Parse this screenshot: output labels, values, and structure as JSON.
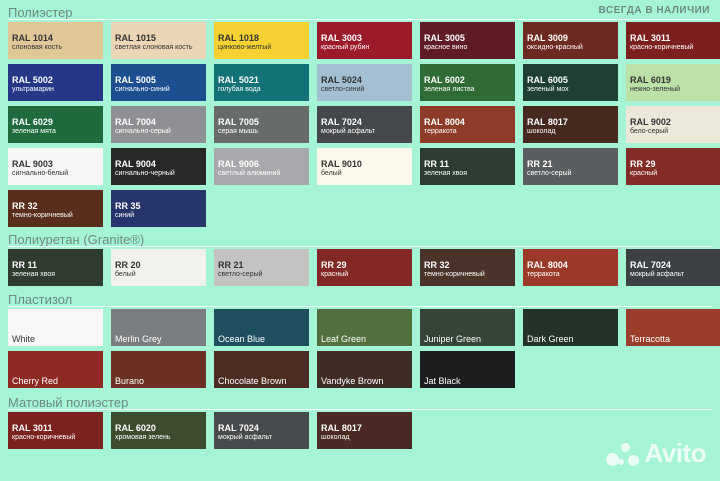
{
  "header": {
    "availability": "ВСЕГДА В НАЛИЧИИ"
  },
  "sections": [
    {
      "title": "Полиэстер",
      "swatches": [
        {
          "code": "RAL 1014",
          "name": "слоновая кость",
          "color": "#dfc798",
          "text": "light"
        },
        {
          "code": "RAL 1015",
          "name": "светлая слоновая кость",
          "color": "#ead5b5",
          "text": "light"
        },
        {
          "code": "RAL 1018",
          "name": "цинково-желтый",
          "color": "#f5d232",
          "text": "light"
        },
        {
          "code": "RAL 3003",
          "name": "красный рубин",
          "color": "#9b1b2b",
          "text": "dark"
        },
        {
          "code": "RAL 3005",
          "name": "красное вино",
          "color": "#5f1c26",
          "text": "dark"
        },
        {
          "code": "RAL 3009",
          "name": "оксидно-красный",
          "color": "#6d2a23",
          "text": "dark"
        },
        {
          "code": "RAL 3011",
          "name": "красно-коричневый",
          "color": "#7b1f1f",
          "text": "dark"
        },
        {
          "code": "RAL 5002",
          "name": "ультрамарин",
          "color": "#273788",
          "text": "dark"
        },
        {
          "code": "RAL 5005",
          "name": "сигнально-синий",
          "color": "#1d4e8f",
          "text": "dark"
        },
        {
          "code": "RAL 5021",
          "name": "голубая вода",
          "color": "#137275",
          "text": "dark"
        },
        {
          "code": "RAL 5024",
          "name": "светло-синий",
          "color": "#a4bfd2",
          "text": "light"
        },
        {
          "code": "RAL 6002",
          "name": "зеленая листва",
          "color": "#2e6b35",
          "text": "dark"
        },
        {
          "code": "RAL 6005",
          "name": "зеленый мох",
          "color": "#1f3f34",
          "text": "dark"
        },
        {
          "code": "RAL 6019",
          "name": "нежно-зеленый",
          "color": "#bde0a6",
          "text": "light"
        },
        {
          "code": "RAL 6029",
          "name": "зеленая мята",
          "color": "#1f6b3e",
          "text": "dark"
        },
        {
          "code": "RAL 7004",
          "name": "сигнально-серый",
          "color": "#8f9093",
          "text": "dark"
        },
        {
          "code": "RAL 7005",
          "name": "серая мышь",
          "color": "#676b6a",
          "text": "dark"
        },
        {
          "code": "RAL 7024",
          "name": "мокрый асфальт",
          "color": "#46494c",
          "text": "dark"
        },
        {
          "code": "RAL 8004",
          "name": "терракота",
          "color": "#8e3c27",
          "text": "dark"
        },
        {
          "code": "RAL 8017",
          "name": "шоколад",
          "color": "#45291f",
          "text": "dark"
        },
        {
          "code": "RAL 9002",
          "name": "бело-серый",
          "color": "#ece8d9",
          "text": "light"
        },
        {
          "code": "RAL 9003",
          "name": "сигнально-белый",
          "color": "#f6f6f4",
          "text": "light"
        },
        {
          "code": "RAL 9004",
          "name": "сигнально-черный",
          "color": "#282828",
          "text": "dark"
        },
        {
          "code": "RAL 9006",
          "name": "светлый алюминий",
          "color": "#a8a9ad",
          "text": "dark"
        },
        {
          "code": "RAL 9010",
          "name": "белый",
          "color": "#fcf9ea",
          "text": "light"
        },
        {
          "code": "RR 11",
          "name": "зеленая хвоя",
          "color": "#2c3c30",
          "text": "dark"
        },
        {
          "code": "RR 21",
          "name": "светло-серый",
          "color": "#5a5e60",
          "text": "dark"
        },
        {
          "code": "RR 29",
          "name": "красный",
          "color": "#832b25",
          "text": "dark"
        },
        {
          "code": "RR 32",
          "name": "темно-коричневый",
          "color": "#5a2e1c",
          "text": "dark"
        },
        {
          "code": "RR 35",
          "name": "синий",
          "color": "#26356b",
          "text": "dark"
        }
      ]
    },
    {
      "title": "Полиуретан (Granite®)",
      "swatches": [
        {
          "code": "RR 11",
          "name": "зеленая хвоя",
          "color": "#2e3b2e",
          "text": "dark"
        },
        {
          "code": "RR 20",
          "name": "белый",
          "color": "#f1f1ee",
          "text": "light"
        },
        {
          "code": "RR 21",
          "name": "светло-серый",
          "color": "#c3c4c2",
          "text": "light"
        },
        {
          "code": "RR 29",
          "name": "красный",
          "color": "#842826",
          "text": "dark"
        },
        {
          "code": "RR 32",
          "name": "темно-коричневый",
          "color": "#4a3328",
          "text": "dark"
        },
        {
          "code": "RAL 8004",
          "name": "терракота",
          "color": "#9c3a29",
          "text": "dark"
        },
        {
          "code": "RAL 7024",
          "name": "мокрый асфальт",
          "color": "#3e4143",
          "text": "dark"
        }
      ]
    },
    {
      "title": "Пластизол",
      "swatches": [
        {
          "label": "White",
          "color": "#f7f7f5",
          "text": "light"
        },
        {
          "label": "Merlin Grey",
          "color": "#7a7d80",
          "text": "dark"
        },
        {
          "label": "Ocean Blue",
          "color": "#1e4f5f",
          "text": "dark"
        },
        {
          "label": "Leaf Green",
          "color": "#52703d",
          "text": "dark"
        },
        {
          "label": "Juniper Green",
          "color": "#344436",
          "text": "dark"
        },
        {
          "label": "Dark Green",
          "color": "#233328",
          "text": "dark"
        },
        {
          "label": "Terracotta",
          "color": "#9a3e2a",
          "text": "dark"
        },
        {
          "label": "Cherry Red",
          "color": "#8e2a24",
          "text": "dark"
        },
        {
          "label": "Burano",
          "color": "#6c3024",
          "text": "dark"
        },
        {
          "label": "Chocolate Brown",
          "color": "#4c2b22",
          "text": "dark"
        },
        {
          "label": "Vandyke Brown",
          "color": "#3e2c25",
          "text": "dark"
        },
        {
          "label": "Jat Black",
          "color": "#1c1d1e",
          "text": "dark"
        }
      ]
    },
    {
      "title": "Матовый полиэстер",
      "swatches": [
        {
          "code": "RAL 3011",
          "name": "красно-коричневый",
          "color": "#7b2220",
          "text": "dark"
        },
        {
          "code": "RAL 6020",
          "name": "хромовая зелень",
          "color": "#3d4b2f",
          "text": "dark"
        },
        {
          "code": "RAL 7024",
          "name": "мокрый асфальт",
          "color": "#484b4d",
          "text": "dark"
        },
        {
          "code": "RAL 8017",
          "name": "шоколад",
          "color": "#4a2a22",
          "text": "dark"
        }
      ]
    }
  ],
  "watermark": {
    "text": "Avito"
  }
}
